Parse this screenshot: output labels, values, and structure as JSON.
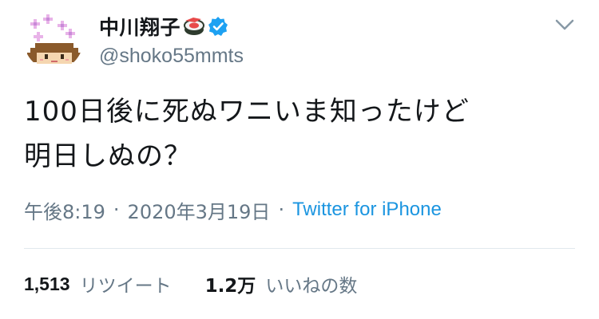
{
  "user": {
    "display_name": "中川翔子",
    "handle": "@shoko55mmts",
    "verified": true,
    "name_emoji": "sushi-icon"
  },
  "tweet": {
    "lines": [
      "100日後に死ぬワニいま知ったけど",
      "明日しぬの？"
    ],
    "time": "午後8:19",
    "date": "2020年3月19日",
    "separator": "·",
    "source": "Twitter for iPhone"
  },
  "stats": {
    "retweets_count": "1,513",
    "retweets_label": "リツイート",
    "likes_count": "1.2万",
    "likes_label": "いいねの数"
  },
  "colors": {
    "text": "#14171a",
    "secondary": "#657786",
    "link": "#1b95e0",
    "verified": "#1da1f2",
    "divider": "#e1e8ed"
  }
}
